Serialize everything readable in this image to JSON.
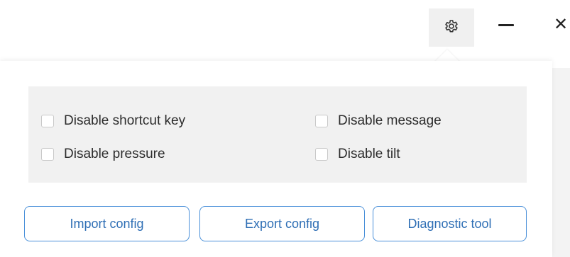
{
  "titlebar": {
    "settings_icon": "gear-icon",
    "minimize_icon": "minimize-icon",
    "close_icon": "close-icon",
    "close_glyph": "✕"
  },
  "options": [
    {
      "label": "Disable shortcut key",
      "checked": false
    },
    {
      "label": "Disable message",
      "checked": false
    },
    {
      "label": "Disable pressure",
      "checked": false
    },
    {
      "label": "Disable tilt",
      "checked": false
    }
  ],
  "actions": {
    "import_label": "Import config",
    "export_label": "Export config",
    "diagnostic_label": "Diagnostic tool"
  },
  "colors": {
    "accent": "#4a90d9",
    "accent_text": "#2f6fb5",
    "options_bg": "#f1f1f1"
  }
}
